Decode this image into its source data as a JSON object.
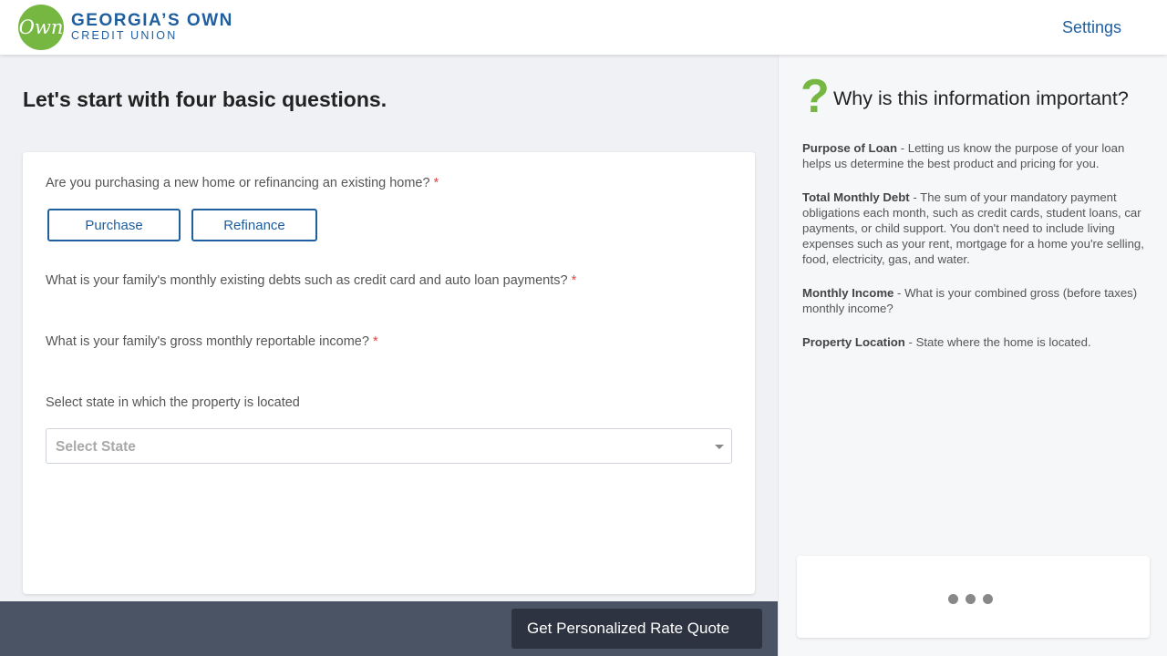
{
  "header": {
    "logo_mark": "Own",
    "logo_name": "GEORGIA’S OWN",
    "logo_sub": "CREDIT UNION",
    "settings_label": "Settings"
  },
  "main": {
    "title": "Let's start with four basic questions.",
    "questions": [
      {
        "label": "Are you purchasing a new home or refinancing an existing home?",
        "required_mark": "*"
      },
      {
        "label": "What is your family's monthly existing debts such as credit card and auto loan payments?",
        "required_mark": "*"
      },
      {
        "label": "What is your family's gross monthly reportable income?",
        "required_mark": "*"
      },
      {
        "label": "Select state in which the property is located"
      }
    ],
    "purpose_options": [
      "Purchase",
      "Refinance"
    ],
    "state_select": {
      "placeholder": "Select State"
    },
    "cta_label": "Get Personalized Rate Quote"
  },
  "sidebar": {
    "icon": "question-mark-icon",
    "title": "Why is this information important?",
    "items": [
      {
        "term": "Purpose of Loan",
        "desc": " - Letting us know the purpose of your loan helps us determine the best product and pricing for you."
      },
      {
        "term": "Total Monthly Debt",
        "desc": " - The sum of your mandatory payment obligations each month, such as credit cards, student loans, car payments, or child support. You don't need to include living expenses such as your rent, mortgage for a home you're selling, food, electricity, gas, and water."
      },
      {
        "term": "Monthly Income",
        "desc": " - What is your combined gross (before taxes) monthly income?"
      },
      {
        "term": "Property Location",
        "desc": " - State where the home is located."
      }
    ],
    "chat_icon": "typing-dots-icon"
  },
  "colors": {
    "brand_blue": "#1f5fa0",
    "brand_green": "#76b742",
    "required_red": "#e04545",
    "footer_bar": "#4b5464",
    "cta_bg": "#2d3340"
  }
}
